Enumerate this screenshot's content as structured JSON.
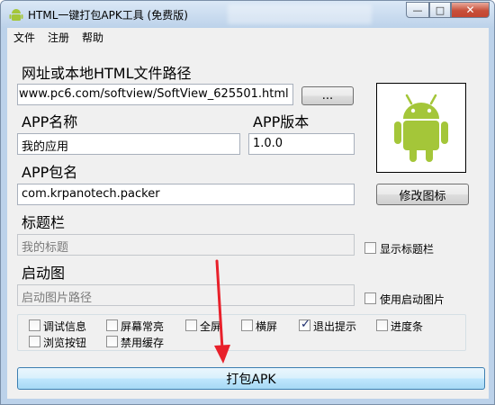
{
  "window": {
    "title": "HTML一键打包APK工具 (免费版)",
    "app_icon": "android-icon",
    "minimize_glyph": "—",
    "maximize_glyph": "□",
    "close_glyph": "✕"
  },
  "menu": {
    "items": [
      "文件",
      "注册",
      "帮助"
    ]
  },
  "form": {
    "url_label": "网址或本地HTML文件路径",
    "url_value": "www.pc6.com/softview/SoftView_625501.html",
    "browse_label": "...",
    "app_name_label": "APP名称",
    "app_name_value": "我的应用",
    "app_version_label": "APP版本",
    "app_version_value": "1.0.0",
    "package_label": "APP包名",
    "package_value": "com.krpanotech.packer",
    "change_icon_label": "修改图标",
    "titlebar_label": "标题栏",
    "titlebar_placeholder": "我的标题",
    "show_titlebar_label": "显示标题栏",
    "splash_label": "启动图",
    "splash_placeholder": "启动图片路径",
    "use_splash_label": "使用启动图片"
  },
  "options": [
    {
      "label": "调试信息",
      "checked": false
    },
    {
      "label": "屏幕常亮",
      "checked": false
    },
    {
      "label": "全屏",
      "checked": false
    },
    {
      "label": "横屏",
      "checked": false
    },
    {
      "label": "退出提示",
      "checked": true
    },
    {
      "label": "进度条",
      "checked": false
    },
    {
      "label": "浏览按钮",
      "checked": false
    },
    {
      "label": "禁用缓存",
      "checked": false
    }
  ],
  "pack_button_label": "打包APK",
  "colors": {
    "android_green": "#a4c639",
    "annotation_arrow": "#e8202a",
    "pack_button_border": "#3c7fb1"
  }
}
